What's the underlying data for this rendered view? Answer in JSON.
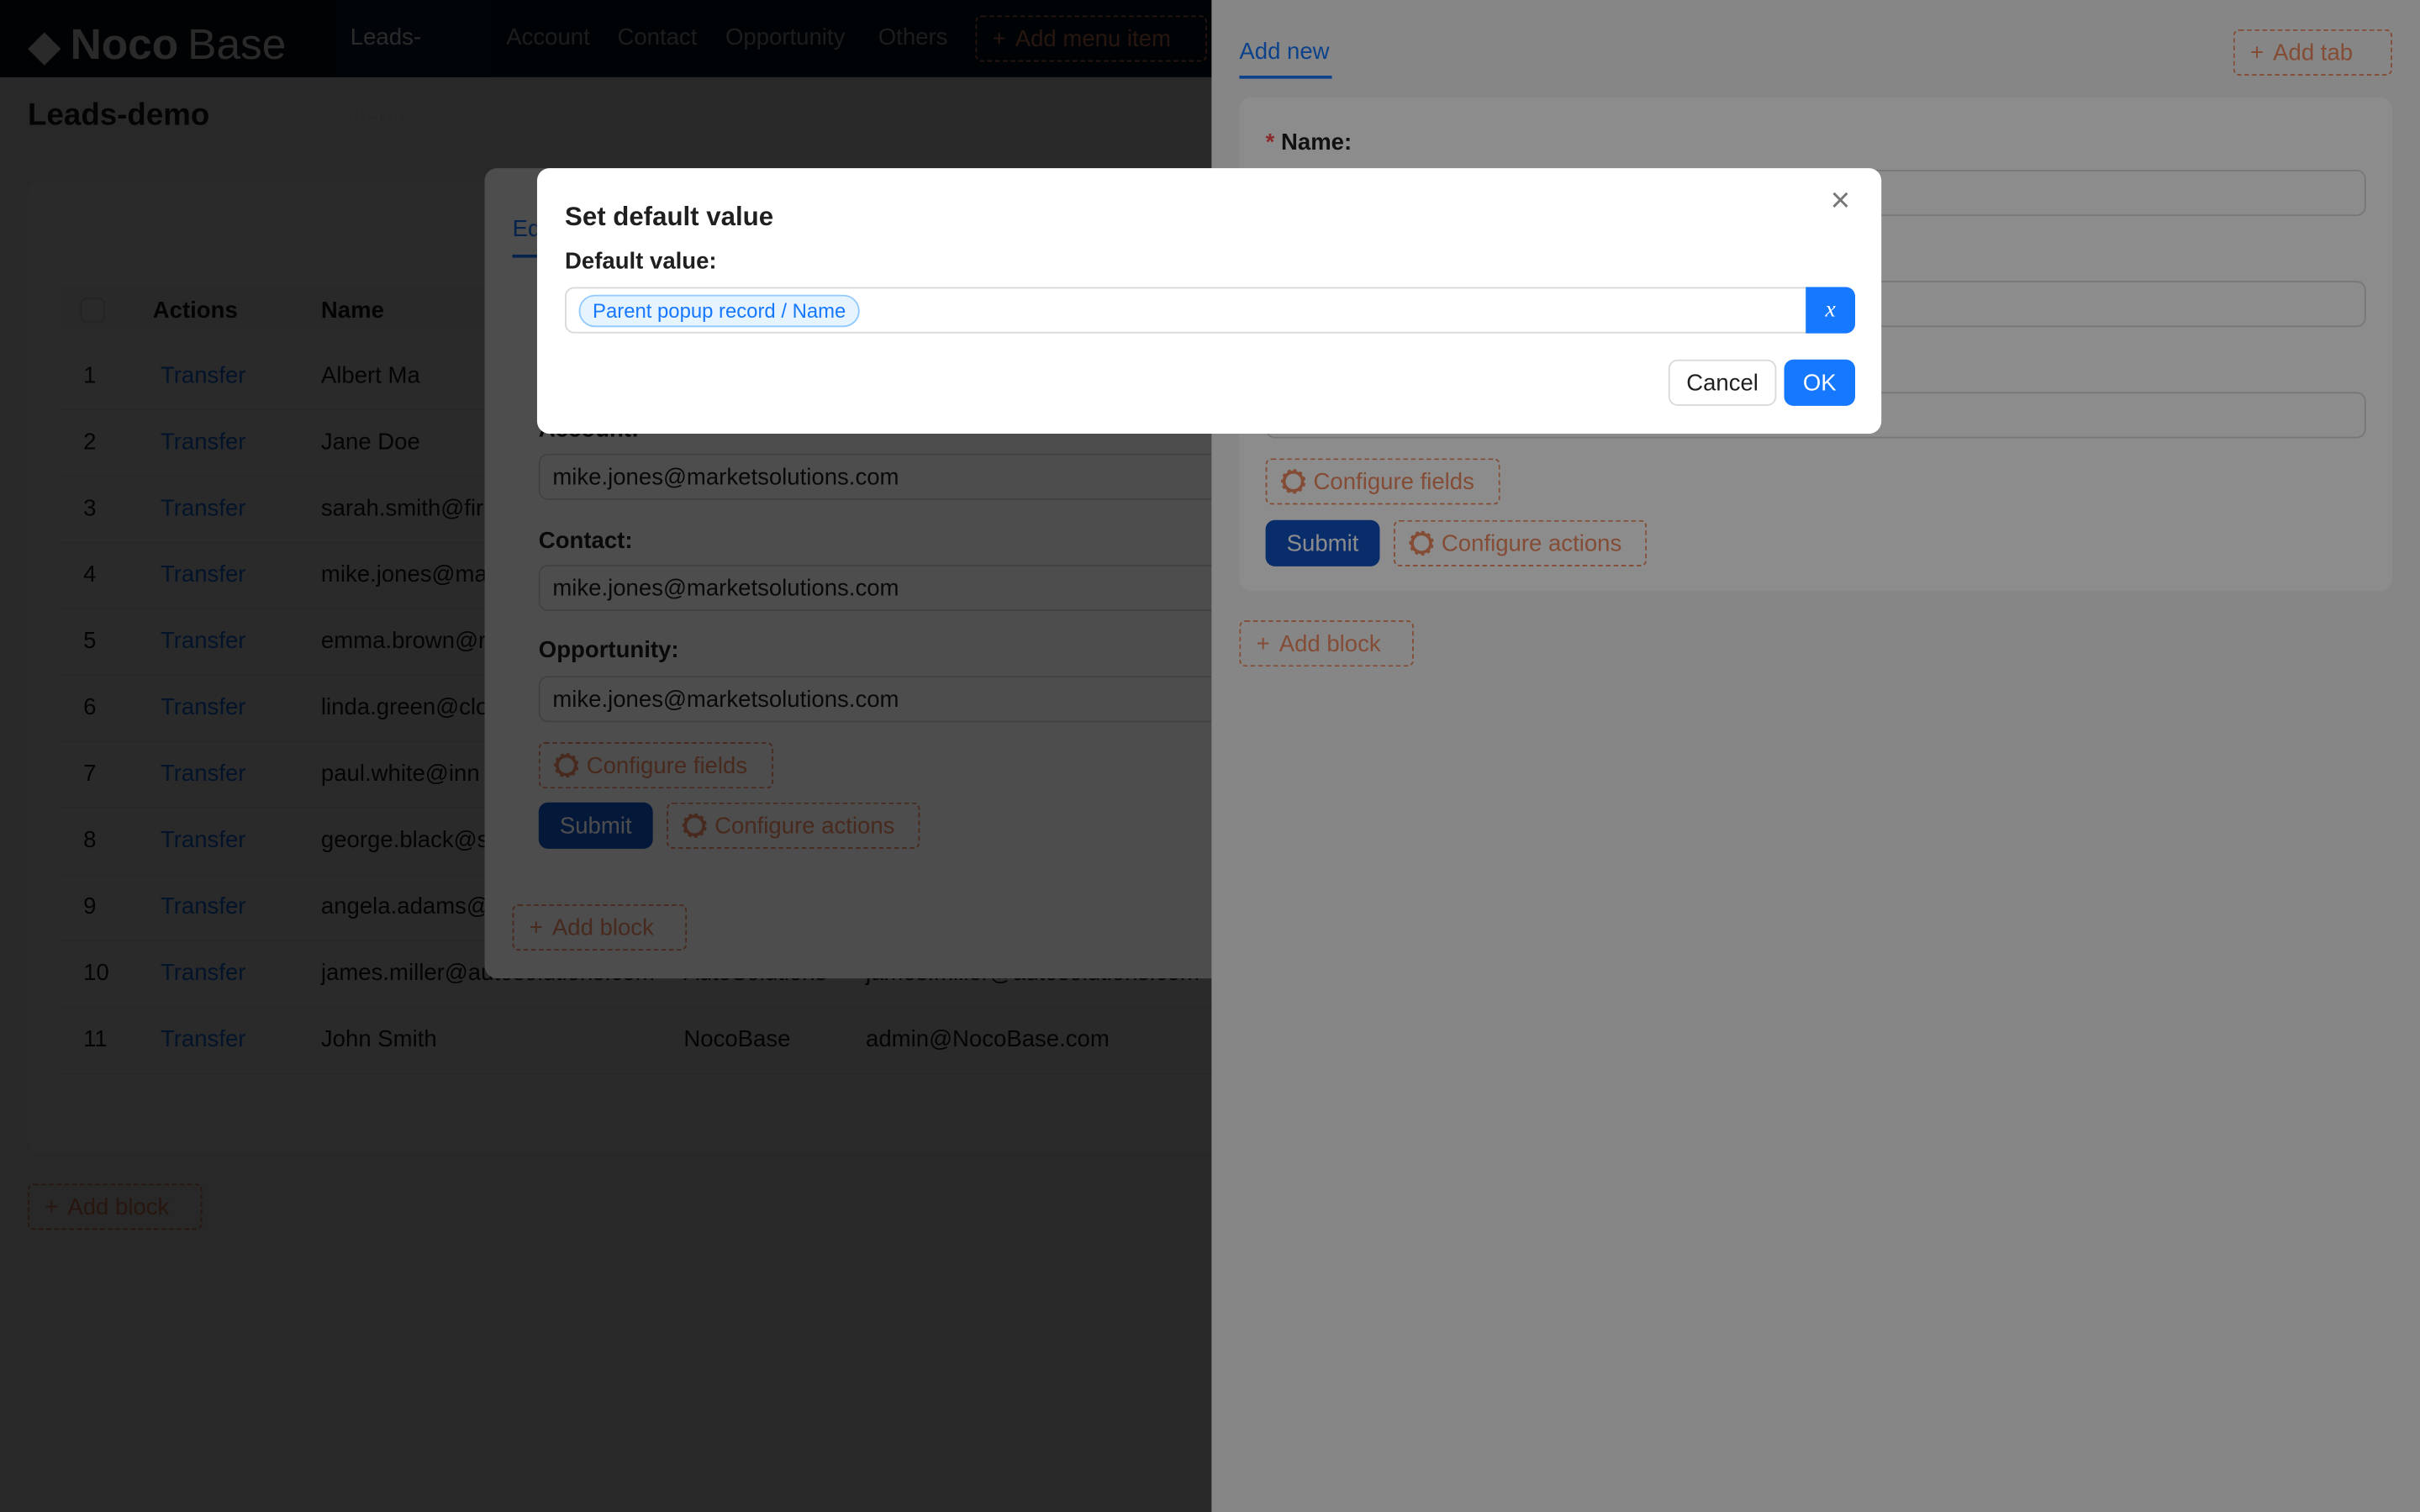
{
  "header": {
    "brand_bold": "Noco",
    "brand_light": "Base",
    "menu": [
      {
        "label": "Leads-demo",
        "active": true
      },
      {
        "label": "Account"
      },
      {
        "label": "Contact"
      },
      {
        "label": "Opportunity"
      },
      {
        "label": "Others"
      }
    ],
    "add_menu_item": "Add menu item"
  },
  "page": {
    "title": "Leads-demo",
    "add_block": "Add block"
  },
  "table": {
    "columns": [
      "Actions",
      "Name"
    ],
    "rows": [
      {
        "no": "1",
        "action": "Transfer",
        "name": "Albert Ma",
        "c4": "",
        "c5": ""
      },
      {
        "no": "2",
        "action": "Transfer",
        "name": "Jane Doe",
        "c4": "",
        "c5": ""
      },
      {
        "no": "3",
        "action": "Transfer",
        "name": "sarah.smith@fir",
        "c4": "",
        "c5": ""
      },
      {
        "no": "4",
        "action": "Transfer",
        "name": "mike.jones@ma",
        "c4": "",
        "c5": ""
      },
      {
        "no": "5",
        "action": "Transfer",
        "name": "emma.brown@r",
        "c4": "",
        "c5": ""
      },
      {
        "no": "6",
        "action": "Transfer",
        "name": "linda.green@clo",
        "c4": "",
        "c5": ""
      },
      {
        "no": "7",
        "action": "Transfer",
        "name": "paul.white@inn",
        "c4": "",
        "c5": ""
      },
      {
        "no": "8",
        "action": "Transfer",
        "name": "george.black@s",
        "c4": "",
        "c5": ""
      },
      {
        "no": "9",
        "action": "Transfer",
        "name": "angela.adams@",
        "c4": "",
        "c5": ""
      },
      {
        "no": "10",
        "action": "Transfer",
        "name": "james.miller@autosolutions.com",
        "c4": "AutoSolutions",
        "c5": "james.miller@autosolutions.com"
      },
      {
        "no": "11",
        "action": "Transfer",
        "name": "John Smith",
        "c4": "NocoBase",
        "c5": "admin@NocoBase.com"
      }
    ]
  },
  "edit_drawer": {
    "tab": "Ed",
    "fields": [
      {
        "label": "Account:",
        "value": "mike.jones@marketsolutions.com"
      },
      {
        "label": "Contact:",
        "value": "mike.jones@marketsolutions.com"
      },
      {
        "label": "Opportunity:",
        "value": "mike.jones@marketsolutions.com"
      }
    ],
    "configure_fields": "Configure fields",
    "submit": "Submit",
    "configure_actions": "Configure actions",
    "add_block": "Add block"
  },
  "add_drawer": {
    "tab": "Add new",
    "add_tab": "Add tab",
    "name_label": "Name:",
    "required_mark": "*",
    "configure_fields": "Configure fields",
    "submit": "Submit",
    "configure_actions": "Configure actions",
    "add_block": "Add block"
  },
  "modal": {
    "title": "Set default value",
    "label": "Default value:",
    "tag": "Parent popup record / Name",
    "var_button": "x",
    "cancel": "Cancel",
    "ok": "OK"
  },
  "colors": {
    "primary": "#1677ff",
    "dashed": "#f18b62"
  }
}
